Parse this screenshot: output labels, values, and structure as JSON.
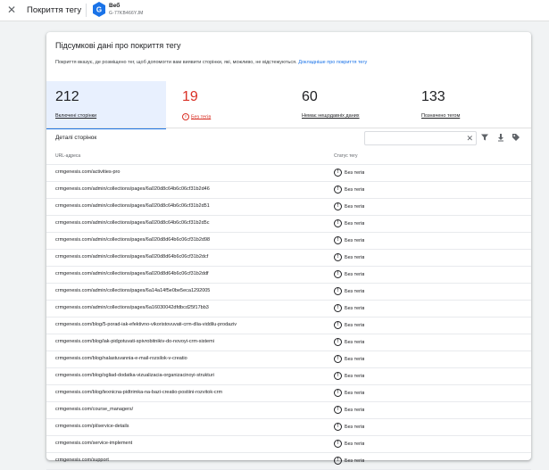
{
  "header": {
    "title": "Покриття тегу",
    "tag_name": "Веб",
    "tag_id": "G-77KB466YJM"
  },
  "card": {
    "title": "Підсумкові дані про покриття тегу",
    "description": "Покриття вказує, де розміщено тег, щоб допомогти вам виявити сторінки, які, можливо, не відстежуються.",
    "learn_more": "Докладніше про покриття тегу"
  },
  "metrics": [
    {
      "value": "212",
      "label": "Включені сторінки"
    },
    {
      "value": "19",
      "label": "Без тегів"
    },
    {
      "value": "60",
      "label": "Немає нещодавніх даних"
    },
    {
      "value": "133",
      "label": "Позначено тегом"
    }
  ],
  "details": {
    "title": "Деталі сторінок",
    "filter_value": "",
    "columns": {
      "url": "URL-адреса",
      "status": "Статус тегу"
    },
    "rows": [
      {
        "url": "crmgenesis.com/activities-pro",
        "status": "Без тегів"
      },
      {
        "url": "crmgenesis.com/admin/collections/pages/6a020d8c64b6c06cf31b2d46",
        "status": "Без тегів"
      },
      {
        "url": "crmgenesis.com/admin/collections/pages/6a020d8c64b6c06cf31b2d51",
        "status": "Без тегів"
      },
      {
        "url": "crmgenesis.com/admin/collections/pages/6a020d8c64b6c06cf31b2d5c",
        "status": "Без тегів"
      },
      {
        "url": "crmgenesis.com/admin/collections/pages/6a020d8d64b6c06cf31b2d98",
        "status": "Без тегів"
      },
      {
        "url": "crmgenesis.com/admin/collections/pages/6a020d8d64b6c06cf31b2dcf",
        "status": "Без тегів"
      },
      {
        "url": "crmgenesis.com/admin/collections/pages/6a020d8d64b6c06cf31b2ddf",
        "status": "Без тегів"
      },
      {
        "url": "crmgenesis.com/admin/collections/pages/6a14a14f5e0be5eca1292005",
        "status": "Без тегів"
      },
      {
        "url": "crmgenesis.com/admin/collections/pages/6a16030042dfdbcd25f17bb3",
        "status": "Без тегів"
      },
      {
        "url": "crmgenesis.com/blog/5-porad-iak-efektivno-vikoristovuvati-crm-dlia-viddilu-prodaziv",
        "status": "Без тегів"
      },
      {
        "url": "crmgenesis.com/blog/iak-pidgotuvati-spivrobitnikiv-do-novoyi-crm-sistemi",
        "status": "Без тегів"
      },
      {
        "url": "crmgenesis.com/blog/nalastuvannia-e-mail-rozsilok-v-creatio",
        "status": "Без тегів"
      },
      {
        "url": "crmgenesis.com/blog/ogliad-dodatka-vizualizacia-organizacinoyi-strukturi",
        "status": "Без тегів"
      },
      {
        "url": "crmgenesis.com/blog/texnicna-pidtrimka-na-bazi-creatio-postiini-rozvitok-crm",
        "status": "Без тегів"
      },
      {
        "url": "crmgenesis.com/course_managers/",
        "status": "Без тегів"
      },
      {
        "url": "crmgenesis.com/pl/service-details",
        "status": "Без тегів"
      },
      {
        "url": "crmgenesis.com/service-implement",
        "status": "Без тегів"
      },
      {
        "url": "crmgenesis.com/support",
        "status": "Без тегів"
      }
    ]
  },
  "icons": {
    "close": "close-icon",
    "tag": "google-tag-icon",
    "filter": "filter-icon",
    "download": "download-icon",
    "tag_settings": "tag-settings-icon",
    "status": "exclamation-circle-icon"
  },
  "colors": {
    "accent": "#1a73e8",
    "error": "#d93025",
    "active_bg": "#e8f0fe"
  }
}
